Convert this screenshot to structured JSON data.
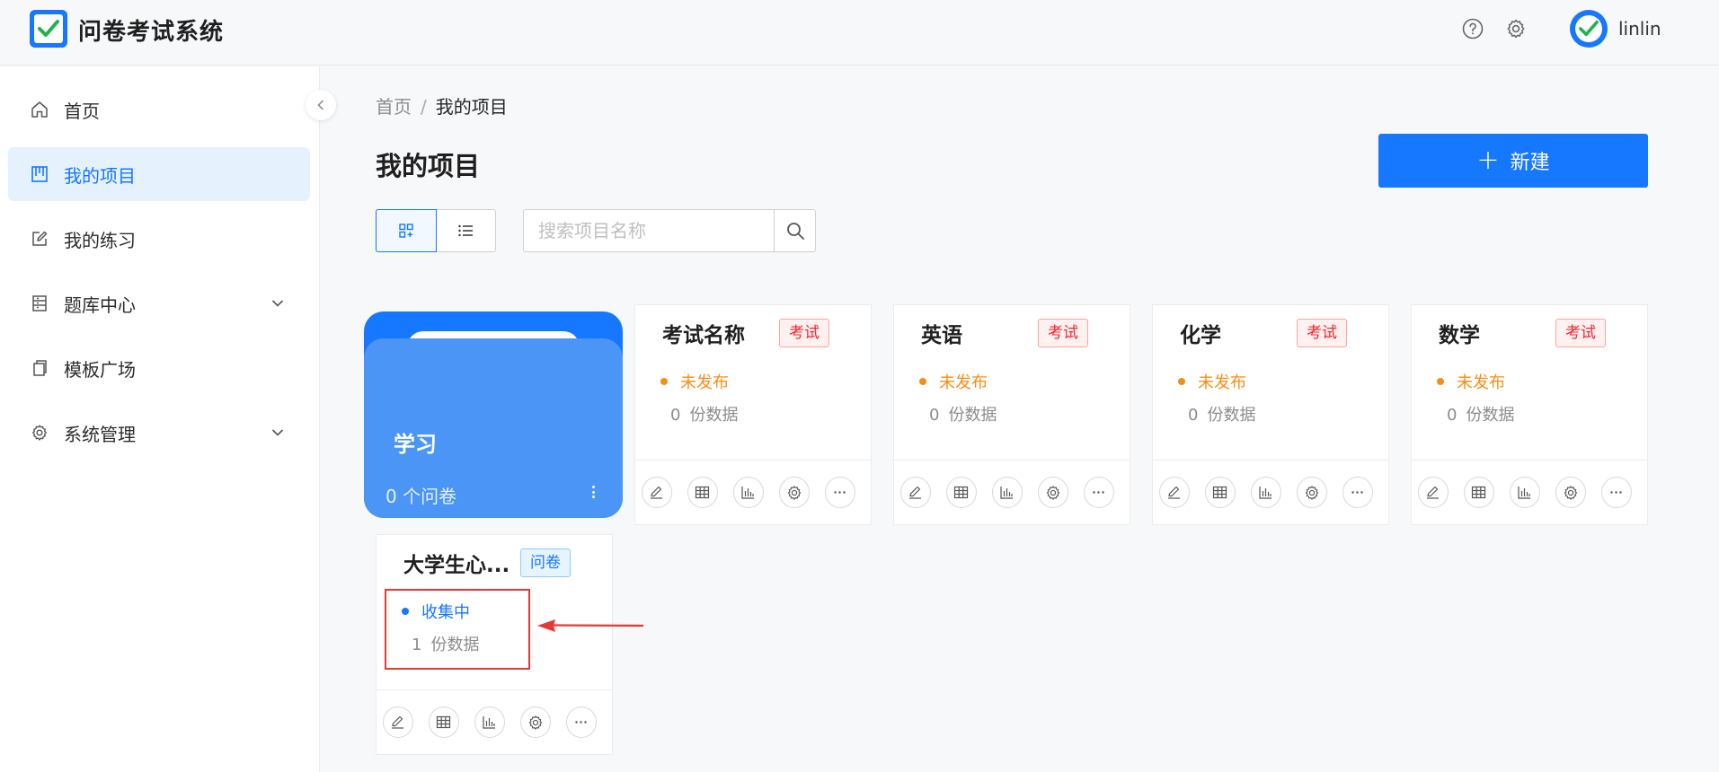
{
  "app": {
    "title": "问卷考试系统"
  },
  "header": {
    "help_icon": "question-circle-icon",
    "settings_icon": "gear-icon",
    "username": "linlin"
  },
  "sidebar": {
    "items": [
      {
        "label": "首页",
        "icon": "home-icon",
        "active": false
      },
      {
        "label": "我的项目",
        "icon": "project-icon",
        "active": true
      },
      {
        "label": "我的练习",
        "icon": "edit-icon",
        "active": false
      },
      {
        "label": "题库中心",
        "icon": "question-bank-icon",
        "active": false,
        "expandable": true
      },
      {
        "label": "模板广场",
        "icon": "copy-icon",
        "active": false
      },
      {
        "label": "系统管理",
        "icon": "gear-icon",
        "active": false,
        "expandable": true
      }
    ]
  },
  "breadcrumb": {
    "home": "首页",
    "sep": "/",
    "current": "我的项目"
  },
  "page": {
    "title": "我的项目",
    "new_button": "新建",
    "new_icon": "+"
  },
  "search": {
    "placeholder": "搜索项目名称",
    "value": ""
  },
  "view": {
    "mode": "grid"
  },
  "folder": {
    "name": "学习",
    "count_label": "0 个问卷"
  },
  "projects": [
    {
      "title": "考试名称",
      "tag": "考试",
      "status": "未发布",
      "count": "0",
      "count_label": "份数据"
    },
    {
      "title": "英语",
      "tag": "考试",
      "status": "未发布",
      "count": "0",
      "count_label": "份数据"
    },
    {
      "title": "化学",
      "tag": "考试",
      "status": "未发布",
      "count": "0",
      "count_label": "份数据"
    },
    {
      "title": "数学",
      "tag": "考试",
      "status": "未发布",
      "count": "0",
      "count_label": "份数据"
    },
    {
      "title": "大学生心...",
      "tag": "问卷",
      "status": "收集中",
      "count": "1",
      "count_label": "份数据"
    }
  ],
  "card_actions": [
    "edit-icon",
    "table-icon",
    "chart-icon",
    "gear-icon",
    "more-icon"
  ],
  "colors": {
    "primary": "#1677ff",
    "sidebar_active_bg": "#e6f1fe",
    "exam_tag": "#f5222d",
    "draft_status": "#fa8c16",
    "annotation": "#e53935"
  }
}
